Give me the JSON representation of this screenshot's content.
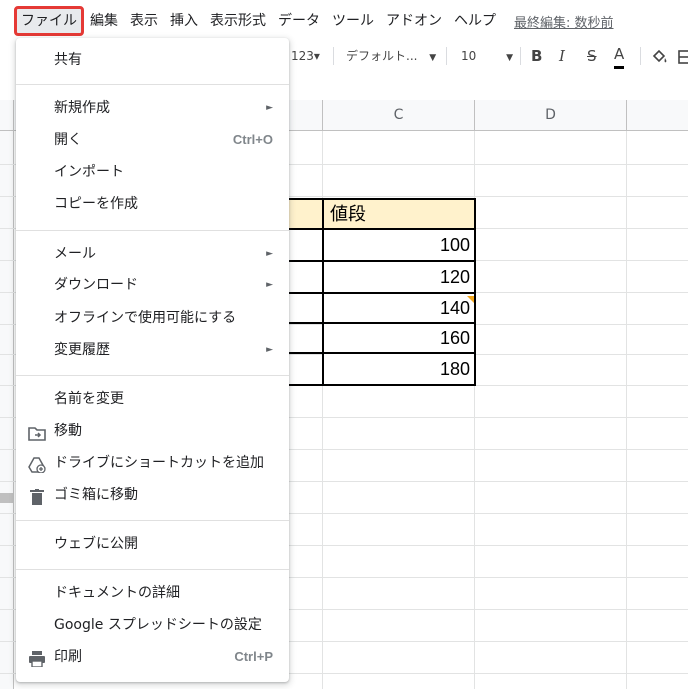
{
  "menubar": {
    "items": [
      "ファイル",
      "編集",
      "表示",
      "挿入",
      "表示形式",
      "データ",
      "ツール",
      "アドオン",
      "ヘルプ"
    ],
    "last_edit": "最終編集: 数秒前"
  },
  "toolbar": {
    "number_format": "123▾",
    "font": "デフォルト...",
    "font_size": "10",
    "bold": "B",
    "italic": "I",
    "strike": "S",
    "text_color": "A"
  },
  "sheet": {
    "columns": [
      "C",
      "D"
    ],
    "header_cell": "値段",
    "values": [
      "100",
      "120",
      "140",
      "160",
      "180"
    ]
  },
  "file_menu": {
    "share": "共有",
    "new": "新規作成",
    "open": "開く",
    "open_shortcut": "Ctrl+O",
    "import": "インポート",
    "make_copy": "コピーを作成",
    "email": "メール",
    "download": "ダウンロード",
    "offline": "オフラインで使用可能にする",
    "version_history": "変更履歴",
    "rename": "名前を変更",
    "move": "移動",
    "add_shortcut": "ドライブにショートカットを追加",
    "trash": "ゴミ箱に移動",
    "publish": "ウェブに公開",
    "details": "ドキュメントの詳細",
    "settings": "Google スプレッドシートの設定",
    "print": "印刷",
    "print_shortcut": "Ctrl+P",
    "submenu_arrow": "►"
  },
  "colors": {
    "highlight_border": "#e53935",
    "header_fill": "#fff2cc",
    "note_marker": "#f4a81d"
  }
}
